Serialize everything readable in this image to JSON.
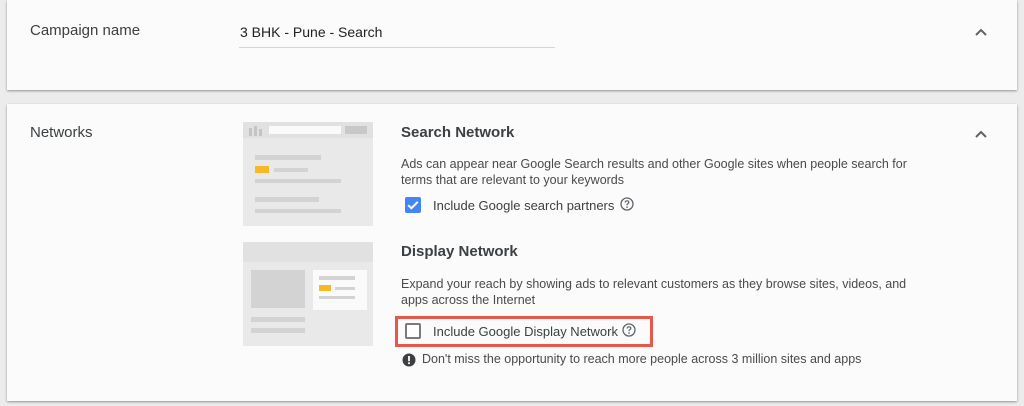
{
  "campaign_name": {
    "label": "Campaign name",
    "value": "3 BHK - Pune - Search"
  },
  "networks": {
    "label": "Networks",
    "search_network": {
      "title": "Search Network",
      "description": "Ads can appear near Google Search results and other Google sites when people search for terms that are relevant to your keywords",
      "checkbox_label": "Include Google search partners",
      "checked": true
    },
    "display_network": {
      "title": "Display Network",
      "description": "Expand your reach by showing ads to relevant customers as they browse sites, videos, and apps across the Internet",
      "checkbox_label": "Include Google Display Network",
      "checked": false
    },
    "warning": "Don't miss the opportunity to reach more people across 3 million sites and apps"
  },
  "colors": {
    "accent_blue": "#4285f4",
    "highlight_red": "#e5584b",
    "illustration_yellow": "#f6b826"
  },
  "icons": {
    "collapse": "chevron-up-icon",
    "help": "help-circle-icon",
    "warning": "exclamation-circle-icon"
  }
}
